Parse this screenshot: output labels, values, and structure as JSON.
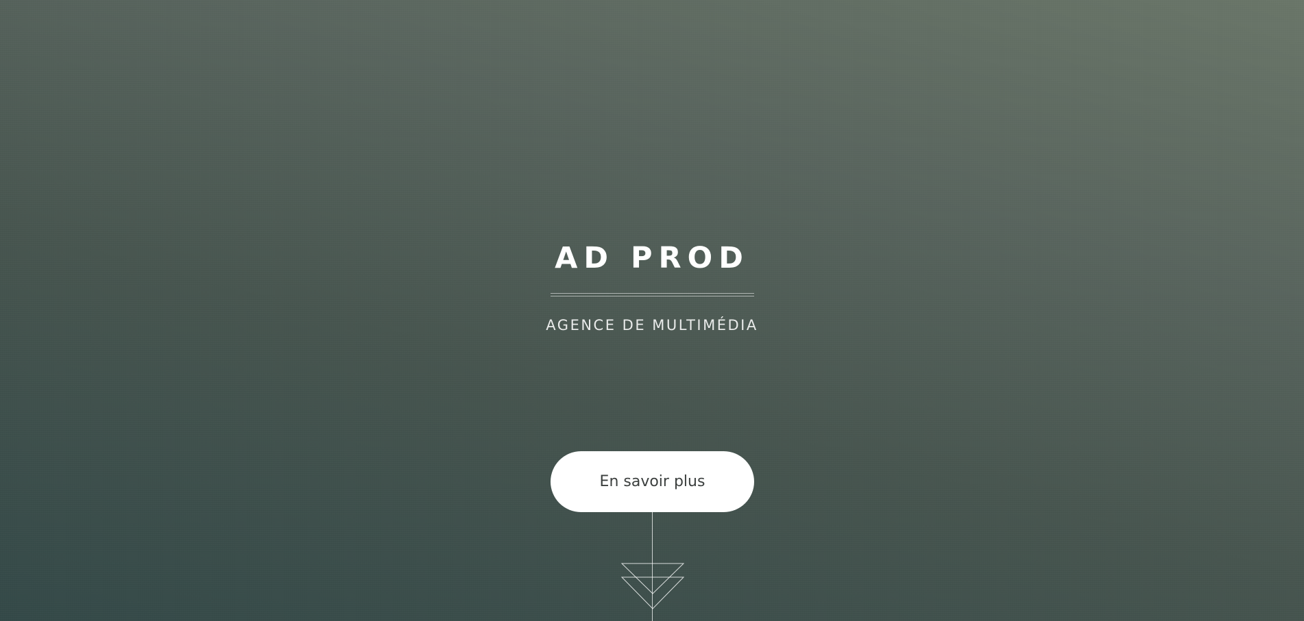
{
  "hero": {
    "title": "AD PROD",
    "subtitle": "AGENCE DE MULTIMÉDIA",
    "cta_label": "En savoir plus",
    "scroll_icon": "double-chevron-down-icon"
  },
  "colors": {
    "gradient_top": "#6a7669",
    "gradient_bottom": "#344948",
    "button_bg": "#ffffff",
    "button_text": "#3b3f3e",
    "text": "#ffffff"
  }
}
